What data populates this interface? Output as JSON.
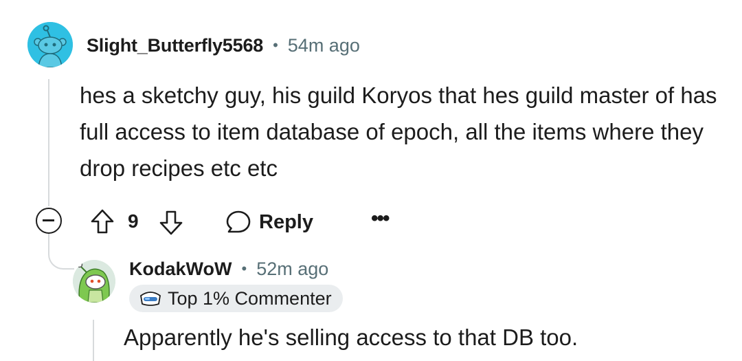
{
  "comment": {
    "username": "Slight_Butterfly5568",
    "separator": "•",
    "time": "54m ago",
    "body": "hes a sketchy guy, his guild Koryos that hes guild master of has full access to item database of epoch, all the items where they drop recipes etc etc",
    "score": "9",
    "reply_label": "Reply",
    "more_label": "•••",
    "avatar_icon": "snoo-avatar-icon",
    "colors": {
      "avatar_bg": "#2fc0e3",
      "meta_text": "#576f76",
      "thread_line": "#d7dadc"
    }
  },
  "reply": {
    "username": "KodakWoW",
    "separator": "•",
    "time": "52m ago",
    "badge": "Top 1% Commenter",
    "badge_icon": "top-commenter-icon",
    "body": "Apparently he's selling access to that DB too.",
    "avatar_icon": "snoo-avatar-icon",
    "colors": {
      "badge_bg": "#eaedef"
    }
  }
}
